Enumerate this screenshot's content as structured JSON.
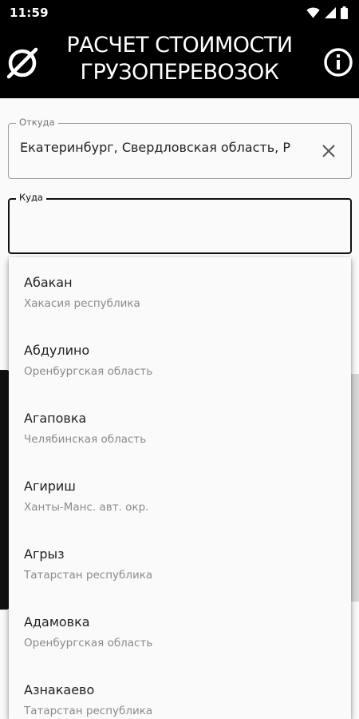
{
  "status_bar": {
    "time": "11:59",
    "icons": [
      "wifi-icon",
      "signal-icon",
      "battery-icon"
    ]
  },
  "app_bar": {
    "title_line1": "РАСЧЕТ СТОИМОСТИ",
    "title_line2": "ГРУЗОПЕРЕВОЗОК",
    "left_icon": "empty-set-icon",
    "right_icon": "info-icon"
  },
  "form": {
    "from": {
      "label": "Откуда",
      "value": "Екатеринбург, Свердловская область, Р"
    },
    "to": {
      "label": "Куда",
      "value": ""
    }
  },
  "suggestions": [
    {
      "city": "Абакан",
      "region": "Хакасия республика"
    },
    {
      "city": "Абдулино",
      "region": "Оренбургская область"
    },
    {
      "city": "Агаповка",
      "region": "Челябинская область"
    },
    {
      "city": "Агириш",
      "region": "Ханты-Манс. авт. окр."
    },
    {
      "city": "Агрыз",
      "region": "Татарстан республика"
    },
    {
      "city": "Адамовка",
      "region": "Оренбургская область"
    },
    {
      "city": "Азнакаево",
      "region": "Татарстан республика"
    }
  ],
  "colors": {
    "app_bar": "#000000",
    "background": "#fafafa",
    "secondary_text": "#8a8a8a"
  }
}
